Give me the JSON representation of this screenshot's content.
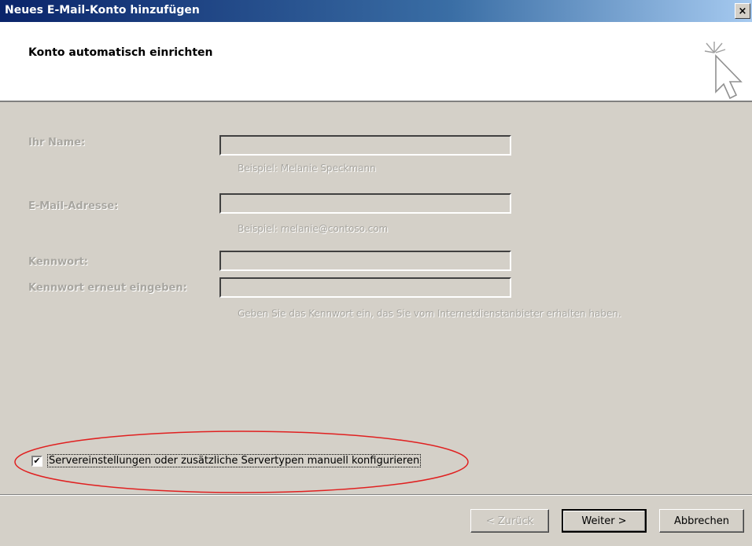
{
  "window": {
    "title": "Neues E-Mail-Konto hinzufügen",
    "close_label": "×"
  },
  "header": {
    "heading": "Konto automatisch einrichten"
  },
  "form": {
    "name_label": "Ihr Name:",
    "name_value": "",
    "name_hint": "Beispiel: Melanie Speckmann",
    "email_label": "E-Mail-Adresse:",
    "email_value": "",
    "email_hint": "Beispiel: melanie@contoso.com",
    "password_label": "Kennwort:",
    "password_value": "",
    "password_confirm_label": "Kennwort erneut eingeben:",
    "password_confirm_value": "",
    "password_hint": "Geben Sie das Kennwort ein, das Sie vom Internetdienstanbieter erhalten haben."
  },
  "manual_config": {
    "checked": true,
    "check_mark": "✔",
    "label": "Servereinstellungen oder zusätzliche Servertypen manuell konfigurieren"
  },
  "buttons": {
    "back": "< Zurück",
    "next": "Weiter >",
    "cancel": "Abbrechen"
  },
  "colors": {
    "annotation_ellipse": "#e02020",
    "title_bar": "#0a246a",
    "disabled_text": "#a8a6a0"
  }
}
